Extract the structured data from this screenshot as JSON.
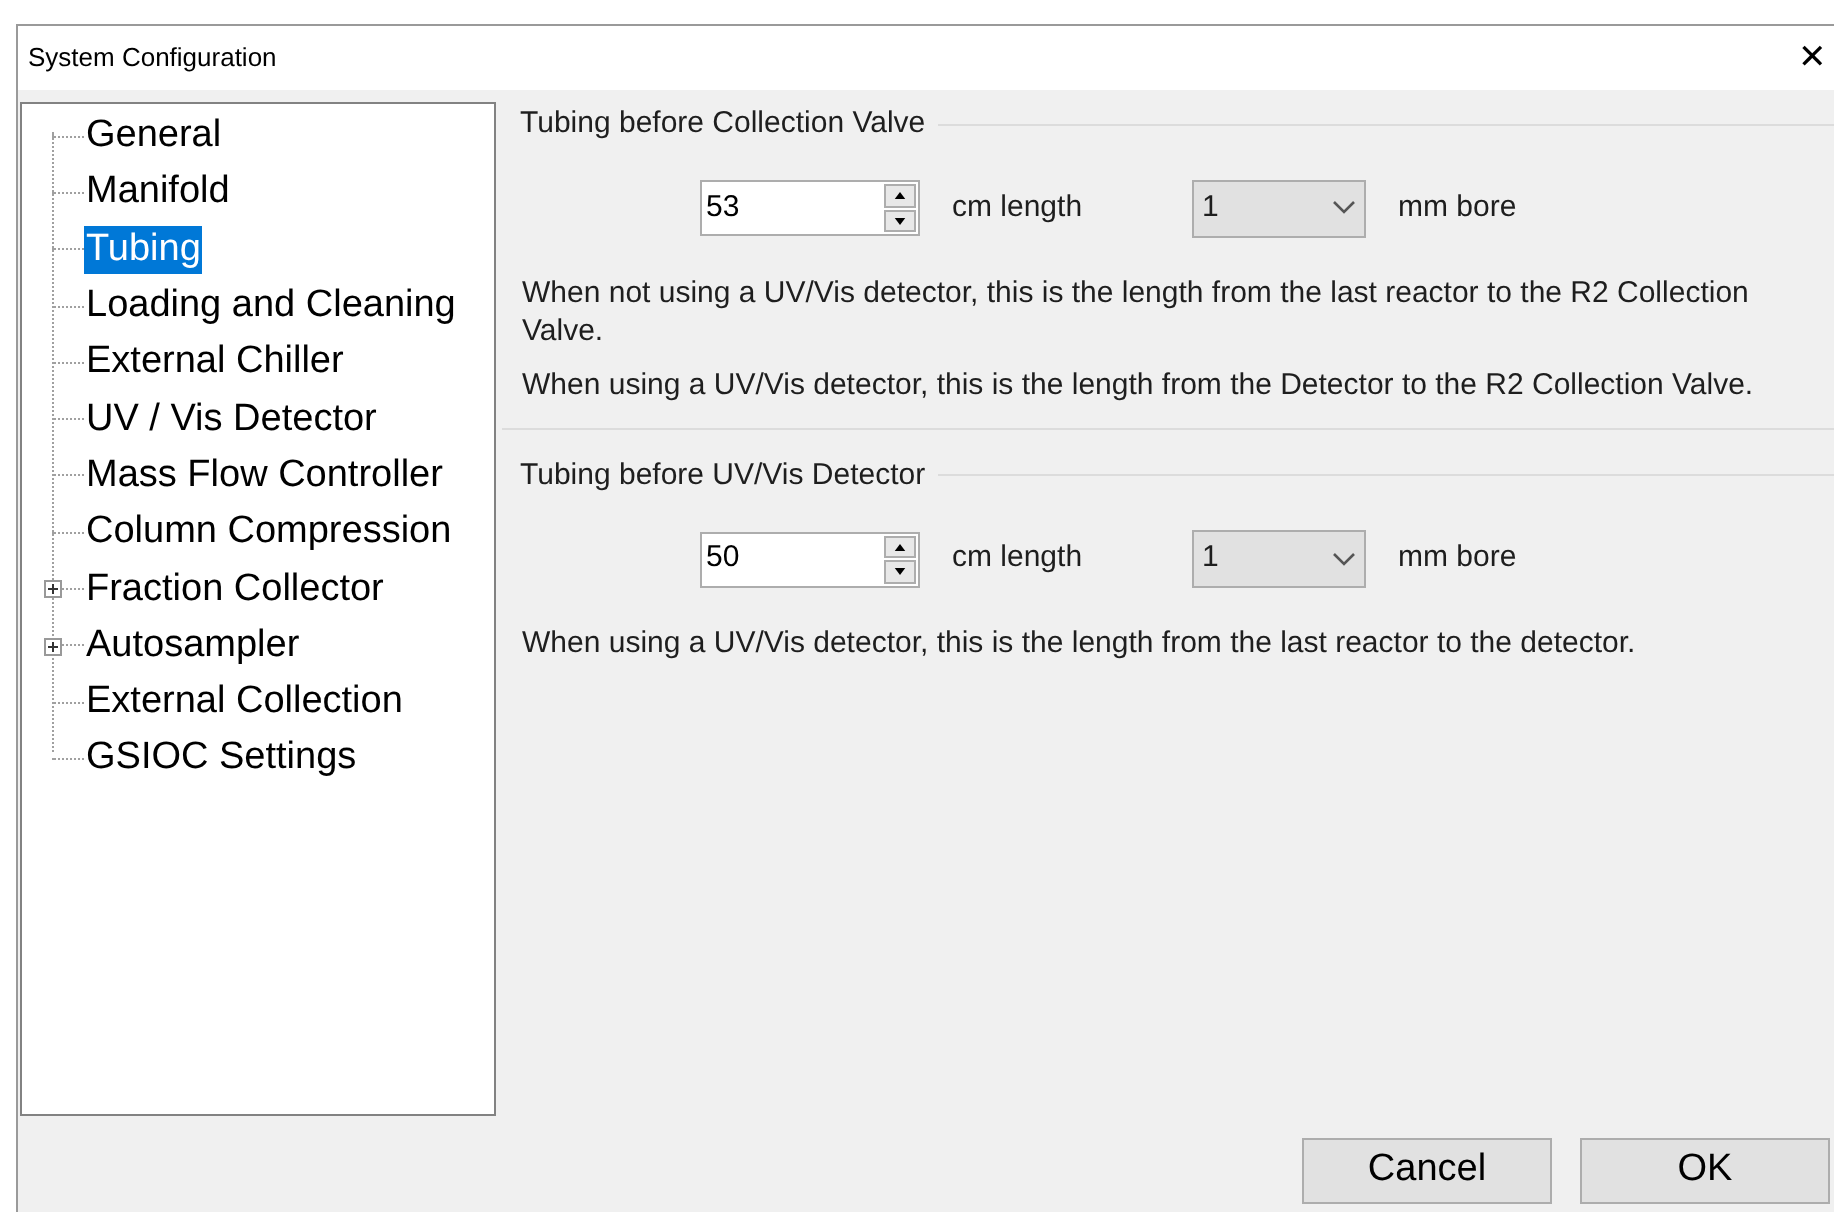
{
  "window": {
    "title": "System Configuration",
    "close": "✕"
  },
  "tree": [
    {
      "label": "General",
      "selected": false,
      "expandable": false
    },
    {
      "label": "Manifold",
      "selected": false,
      "expandable": false
    },
    {
      "label": "Tubing",
      "selected": true,
      "expandable": false
    },
    {
      "label": "Loading and Cleaning",
      "selected": false,
      "expandable": false
    },
    {
      "label": "External Chiller",
      "selected": false,
      "expandable": false
    },
    {
      "label": "UV / Vis Detector",
      "selected": false,
      "expandable": false
    },
    {
      "label": "Mass Flow Controller",
      "selected": false,
      "expandable": false
    },
    {
      "label": "Column Compression",
      "selected": false,
      "expandable": false
    },
    {
      "label": "Fraction Collector",
      "selected": false,
      "expandable": true
    },
    {
      "label": "Autosampler",
      "selected": false,
      "expandable": true
    },
    {
      "label": "External Collection",
      "selected": false,
      "expandable": false
    },
    {
      "label": "GSIOC Settings",
      "selected": false,
      "expandable": false
    }
  ],
  "sections": [
    {
      "title": "Tubing before Collection Valve",
      "length": "53",
      "length_unit": "cm length",
      "bore": "1",
      "bore_unit": "mm bore",
      "notes": [
        "When not using a UV/Vis detector, this is the length  from the last reactor to the R2 Collection Valve.",
        "When using a UV/Vis detector, this is the length from the Detector to the R2 Collection Valve."
      ]
    },
    {
      "title": "Tubing before UV/Vis Detector",
      "length": "50",
      "length_unit": "cm length",
      "bore": "1",
      "bore_unit": "mm bore",
      "notes": [
        "When using a UV/Vis detector, this is the length from the last reactor to the detector."
      ]
    }
  ],
  "buttons": [
    "Cancel",
    "OK"
  ]
}
